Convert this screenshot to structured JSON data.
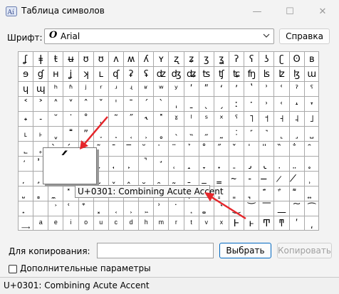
{
  "window": {
    "title": "Таблица символов",
    "minimize_glyph": "—",
    "maximize_glyph": "☐",
    "close_glyph": "✕"
  },
  "font": {
    "label": "Шрифт:",
    "value": "Arial",
    "icon_glyph": "O"
  },
  "buttons": {
    "help": "Справка",
    "select": "Выбрать",
    "copy": "Копировать"
  },
  "grid": {
    "rows": [
      [
        "ʆ",
        "ǂ",
        "ŧ",
        "ʉ",
        "ʊ",
        "ʊ",
        "ʌ",
        "ʍ",
        "ʎ",
        "ʏ",
        "ʐ",
        "ʑ",
        "ʒ",
        "ʓ",
        "ʔ",
        "ʕ",
        "ʖ",
        "ʗ",
        "ʘ",
        "ʙ"
      ],
      [
        "ɘ",
        "ɠ",
        "ʜ",
        "ʝ",
        "ʞ",
        "ʟ",
        "ʠ",
        "ʡ",
        "ʢ",
        "ʣ",
        "ʤ",
        "ʥ",
        "ʦ",
        "ʧ",
        "ʨ",
        "ʩ",
        "ʪ",
        "ʫ",
        "ɮ",
        "ɯ"
      ],
      [
        "ɥ",
        "ɰ",
        "ʰ",
        "ʱ",
        "ʲ",
        "ʳ",
        "ʴ",
        "ʵ",
        "ʶ",
        "ʷ",
        "ʸ",
        "ʹ",
        "ʺ",
        "ʻ",
        "ʼ",
        "ʽ",
        "ʾ",
        "ʿ",
        "ˀ",
        "ˁ"
      ],
      [
        "˂",
        "˃",
        "˄",
        "˅",
        "ˆ",
        "ˇ",
        "ˈ",
        "ˉ",
        "ˊ",
        "ˋ",
        "ˌ",
        "ˍ",
        "ˎ",
        "ˏ",
        "ː",
        "ˑ",
        "˒",
        "˓",
        "˔",
        "˕"
      ],
      [
        "˖",
        "˗",
        "˘",
        "˙",
        "˚",
        "˛",
        "˜",
        "˝",
        "˞",
        "˟",
        "ˠ",
        "ˡ",
        "ˢ",
        "ˣ",
        "ˤ",
        "˥",
        "˦",
        "˧",
        "˨",
        "˩"
      ],
      [
        "˪",
        "˫",
        "ˬ",
        "˭",
        "ˮ",
        "˯",
        "˰",
        "˱",
        "˲",
        "˳",
        "˴",
        "˵",
        "˶",
        "˷",
        "˸",
        "˹",
        "˺",
        "˻",
        "˼",
        "˽"
      ],
      [
        "˾",
        "˿",
        "̀",
        "́",
        "̂",
        "̃",
        "̄",
        "̅",
        "̆",
        "̇",
        "̈",
        "̉",
        "̊",
        "̋",
        "̌",
        "̍",
        "̎",
        "̏",
        "̐",
        "̑"
      ],
      [
        "̒",
        "̓",
        "̔",
        "̕",
        "̖",
        "̗",
        "̘",
        "̙",
        "̚",
        "̛",
        "̜",
        "̝",
        "̞",
        "̟",
        "̠",
        "̡",
        "̢",
        "̣",
        "̤",
        "̥"
      ],
      [
        "̦",
        "̧",
        "̨",
        "̩",
        "̪",
        "̫",
        "̬",
        "̭",
        "̮",
        "̯",
        "̰",
        "̱",
        "̲",
        "̳",
        "̴",
        "̵",
        "̶",
        "̷",
        "̸",
        "̹"
      ],
      [
        "̺",
        "̻",
        "̼",
        "̽",
        "̾",
        "̿",
        "̀",
        "́",
        "͂",
        "̓",
        "̈́",
        "ͅ",
        "͆",
        "͇",
        "͈",
        "͉",
        "͊",
        "͋",
        "͌",
        "͍"
      ],
      [
        "͎",
        "͏",
        "͐",
        "͑",
        "͒",
        "͓",
        "͔",
        "͕",
        "͖",
        "͗",
        "͘",
        "͙",
        "͚",
        "͛",
        "͜",
        "͝",
        "͞",
        "͟",
        "͠",
        "͡"
      ],
      [
        "͢",
        "ͣ",
        "ͤ",
        "ͥ",
        "ͦ",
        "ͧ",
        "ͨ",
        "ͩ",
        "ͪ",
        "ͫ",
        "ͬ",
        "ͭ",
        "ͮ",
        "ͯ",
        "Ͱ",
        "ͱ",
        "Ͳ",
        "ͳ",
        "ʹ",
        "͵"
      ]
    ],
    "magnified_char": "́",
    "tooltip": "U+0301: Combining Acute Accent"
  },
  "copy": {
    "label": "Для копирования:",
    "value": ""
  },
  "advanced": {
    "label": "Дополнительные параметры",
    "checked": false
  },
  "status": {
    "text": "U+0301: Combining Acute Accent"
  },
  "colors": {
    "accent": "#0067c0",
    "annotation_arrow": "#e5262b"
  }
}
